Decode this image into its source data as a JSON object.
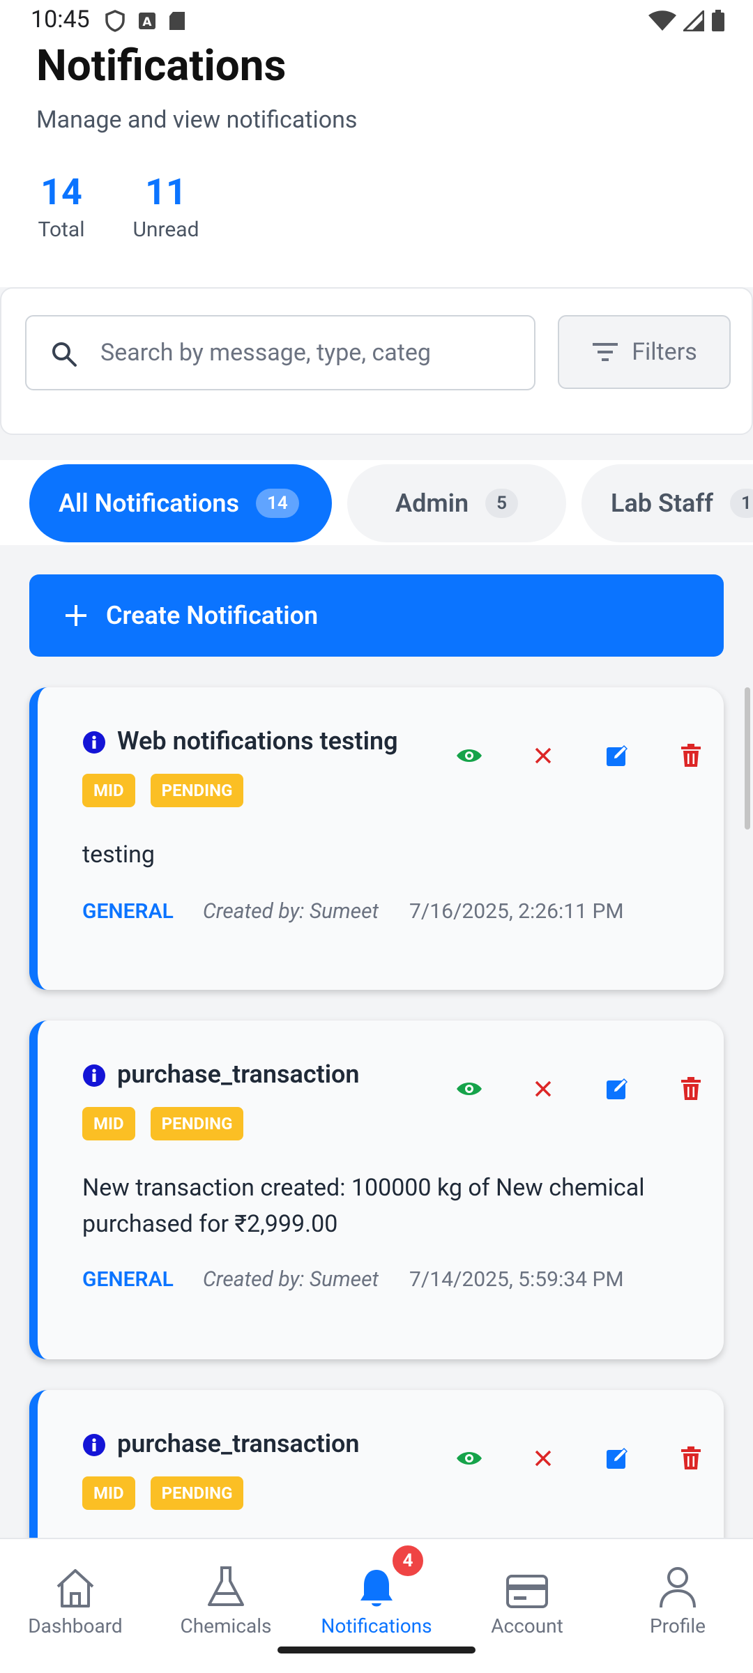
{
  "status_bar": {
    "time": "10:45"
  },
  "header": {
    "title": "Notifications",
    "subtitle": "Manage and view notifications",
    "stats": [
      {
        "value": "14",
        "label": "Total"
      },
      {
        "value": "11",
        "label": "Unread"
      }
    ]
  },
  "search": {
    "placeholder": "Search by message, type, categ",
    "filters_label": "Filters"
  },
  "tabs": [
    {
      "label": "All Notifications",
      "count": "14",
      "active": true
    },
    {
      "label": "Admin",
      "count": "5",
      "active": false
    },
    {
      "label": "Lab Staff",
      "count": "1",
      "active": false
    }
  ],
  "create_button": {
    "label": "Create Notification"
  },
  "notifications": [
    {
      "title": "Web notifications testing",
      "badges": [
        "MID",
        "PENDING"
      ],
      "message": "testing",
      "category": "GENERAL",
      "created_by": "Created by: Sumeet",
      "date": "7/16/2025, 2:26:11 PM"
    },
    {
      "title": "purchase_transaction",
      "badges": [
        "MID",
        "PENDING"
      ],
      "message": "New transaction created: 100000 kg of New chemical purchased for ₹2,999.00",
      "category": "GENERAL",
      "created_by": "Created by: Sumeet",
      "date": "7/14/2025, 5:59:34 PM"
    },
    {
      "title": "purchase_transaction",
      "badges": [
        "MID",
        "PENDING"
      ]
    }
  ],
  "bottom_nav": [
    {
      "label": "Dashboard",
      "icon": "home-icon"
    },
    {
      "label": "Chemicals",
      "icon": "flask-icon"
    },
    {
      "label": "Notifications",
      "icon": "bell-icon",
      "active": true,
      "badge": "4"
    },
    {
      "label": "Account",
      "icon": "card-icon"
    },
    {
      "label": "Profile",
      "icon": "person-icon"
    }
  ],
  "colors": {
    "primary": "#0b74ff",
    "badge": "#fbbf24",
    "view": "#16a34a",
    "dismiss": "#dc2626",
    "edit": "#0b74ff",
    "delete": "#dc2626"
  }
}
